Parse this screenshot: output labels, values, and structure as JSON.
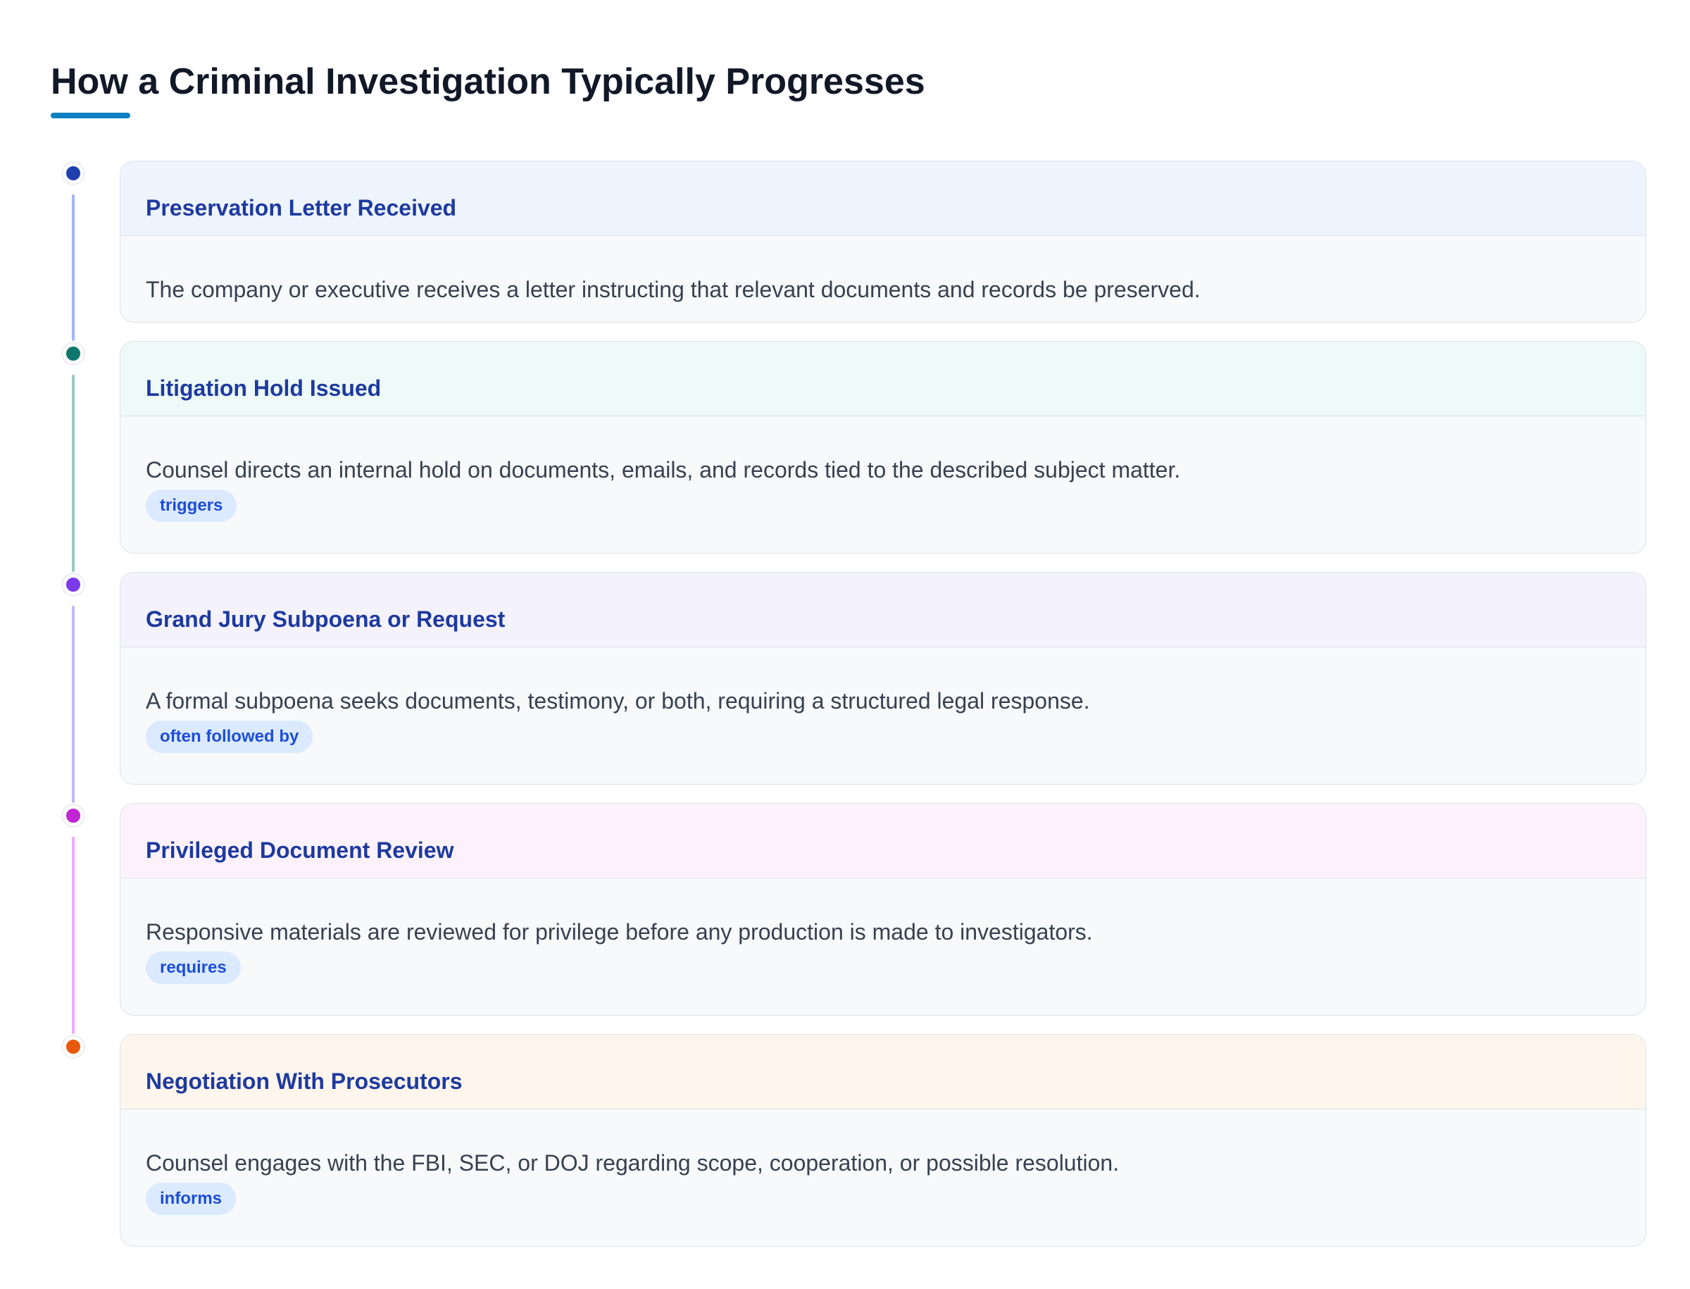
{
  "page": {
    "title": "How a Criminal Investigation Typically Progresses",
    "accent_color": "#0a7fc2"
  },
  "steps": [
    {
      "title": "Preservation Letter Received",
      "description": "The company or executive receives a letter instructing that relevant documents and records be preserved.",
      "tag": "",
      "dot_color": "#1e40af",
      "line_color": "#a5b4fc",
      "header_bg": "#eef4fe"
    },
    {
      "title": "Litigation Hold Issued",
      "description": "Counsel directs an internal hold on documents, emails, and records tied to the described subject matter.",
      "tag": "triggers",
      "dot_color": "#0f766e",
      "line_color": "#99c9c2",
      "header_bg": "#edfaf7"
    },
    {
      "title": "Grand Jury Subpoena or Request",
      "description": "A formal subpoena seeks documents, testimony, or both, requiring a structured legal response.",
      "tag": "often followed by",
      "dot_color": "#7c3aed",
      "line_color": "#c4b5fd",
      "header_bg": "#f3f2fd"
    },
    {
      "title": "Privileged Document Review",
      "description": "Responsive materials are reviewed for privilege before any production is made to investigators.",
      "tag": "requires",
      "dot_color": "#c026d3",
      "line_color": "#f0abfc",
      "header_bg": "#fdf2fc"
    },
    {
      "title": "Negotiation With Prosecutors",
      "description": "Counsel engages with the FBI, SEC, or DOJ regarding scope, cooperation, or possible resolution.",
      "tag": "informs",
      "dot_color": "#ea580c",
      "line_color": "",
      "header_bg": "#fef5ed"
    }
  ]
}
